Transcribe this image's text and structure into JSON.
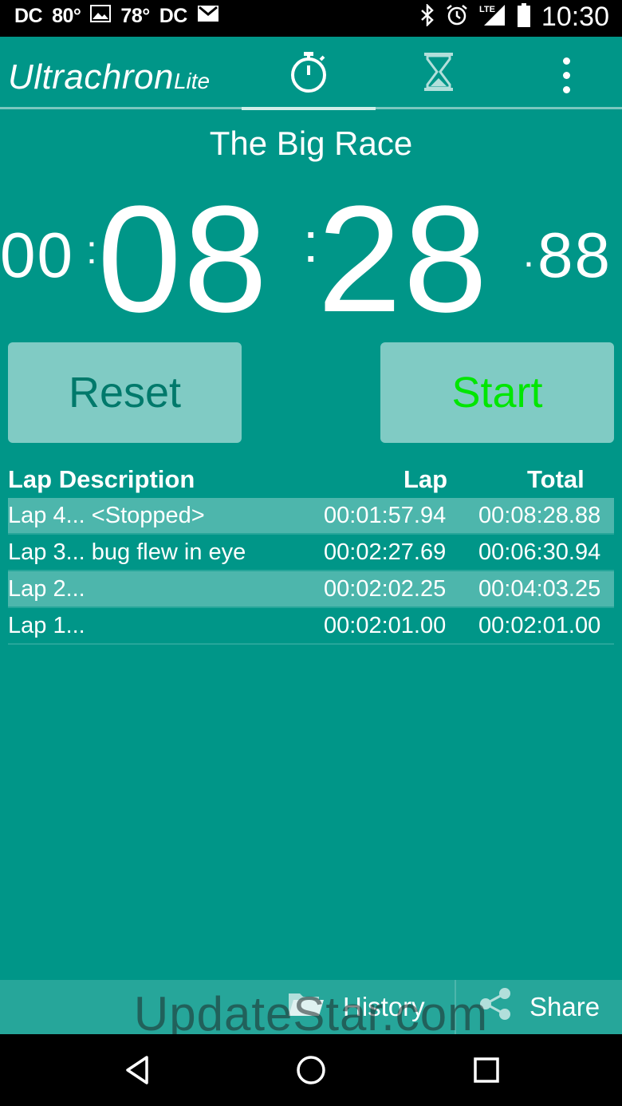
{
  "status_bar": {
    "left_items": [
      "DC",
      "80°",
      "78°",
      "DC"
    ],
    "time": "10:30",
    "network": "LTE"
  },
  "toolbar": {
    "brand_main": "Ultrachron",
    "brand_lite": "Lite",
    "tabs": [
      {
        "name": "stopwatch",
        "icon": "stopwatch-icon",
        "selected": true
      },
      {
        "name": "timer",
        "icon": "hourglass-icon",
        "selected": false
      }
    ],
    "overflow_icon": "more-vert-icon"
  },
  "race_title": "The Big Race",
  "clock": {
    "hours": "00",
    "sep1": ":",
    "minutes": "08",
    "sep2": ":",
    "seconds": "28",
    "dot": ".",
    "fraction": "88"
  },
  "buttons": {
    "reset_label": "Reset",
    "start_label": "Start"
  },
  "laps": {
    "headers": {
      "description": "Lap Description",
      "lap": "Lap",
      "total": "Total"
    },
    "rows": [
      {
        "description": "Lap 4... <Stopped>",
        "lap": "00:01:57.94",
        "total": "00:08:28.88"
      },
      {
        "description": "Lap 3... bug flew in eye",
        "lap": "00:02:27.69",
        "total": "00:06:30.94"
      },
      {
        "description": "Lap 2...",
        "lap": "00:02:02.25",
        "total": "00:04:03.25"
      },
      {
        "description": "Lap 1...",
        "lap": "00:02:01.00",
        "total": "00:02:01.00"
      }
    ]
  },
  "bottom_bar": {
    "history_label": "History",
    "share_label": "Share"
  },
  "watermark": "UpdateStar.com",
  "colors": {
    "app_bg": "#009688",
    "button_bg": "#80cbc4",
    "start_text": "#00e600",
    "reset_text": "#00796b"
  }
}
